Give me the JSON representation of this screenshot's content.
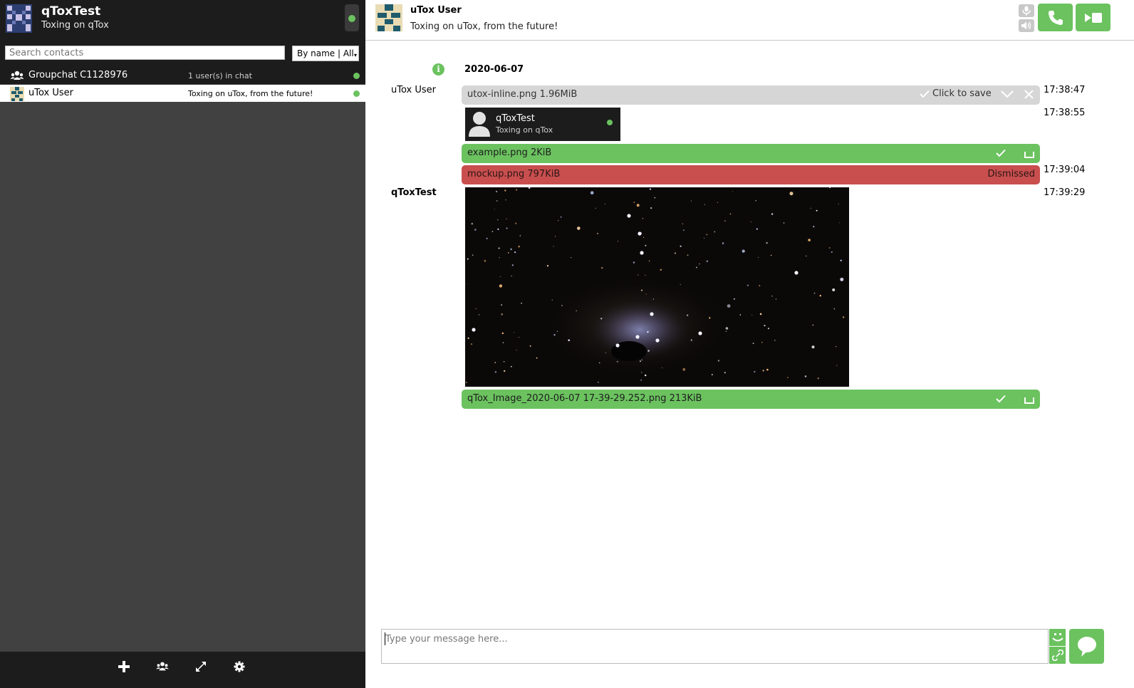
{
  "profile": {
    "name": "qToxTest",
    "status_message": "Toxing on qTox",
    "online_status": "online"
  },
  "search": {
    "placeholder": "Search contacts",
    "filter_label": "By name | All"
  },
  "contacts": [
    {
      "name": "Groupchat C1128976",
      "status": "1 user(s) in chat",
      "type": "group",
      "online": true
    },
    {
      "name": "uTox User",
      "status": "Toxing on uTox, from the future!",
      "type": "friend",
      "online": true,
      "selected": true
    }
  ],
  "chat": {
    "peer_name": "uTox User",
    "peer_status": "Toxing on uTox, from the future!",
    "date": "2020-06-07",
    "messages": [
      {
        "author": "uTox User",
        "time": "17:38:47",
        "file": {
          "name": "utox-inline.png 1.96MiB",
          "action_label": "Click to save",
          "state": "incoming"
        }
      },
      {
        "time": "17:38:55",
        "contact_card": {
          "name": "qToxTest",
          "status": "Toxing on qTox"
        },
        "file": {
          "name": "example.png 2KiB",
          "state": "finished"
        }
      },
      {
        "time": "17:39:04",
        "file": {
          "name": "mockup.png 797KiB",
          "state_label": "Dismissed",
          "state": "cancelled"
        }
      },
      {
        "author": "qToxTest",
        "time": "17:39:29",
        "image": "nebula-photo",
        "file": {
          "name": "qTox_Image_2020-06-07 17-39-29.252.png 213KiB",
          "state": "finished"
        }
      }
    ]
  },
  "input": {
    "placeholder": "Type your message here..."
  },
  "colors": {
    "accent": "#6bc25f",
    "danger": "#c94e4e",
    "sidebar_dark": "#1c1c1c",
    "sidebar_bg": "#414141"
  },
  "icons": [
    "add-contact-icon",
    "group-icon",
    "transfers-icon",
    "settings-icon",
    "microphone-icon",
    "speaker-icon",
    "phone-icon",
    "video-icon",
    "emoji-icon",
    "attach-icon",
    "send-icon",
    "info-icon",
    "check-icon",
    "cancel-icon",
    "open-folder-icon"
  ]
}
